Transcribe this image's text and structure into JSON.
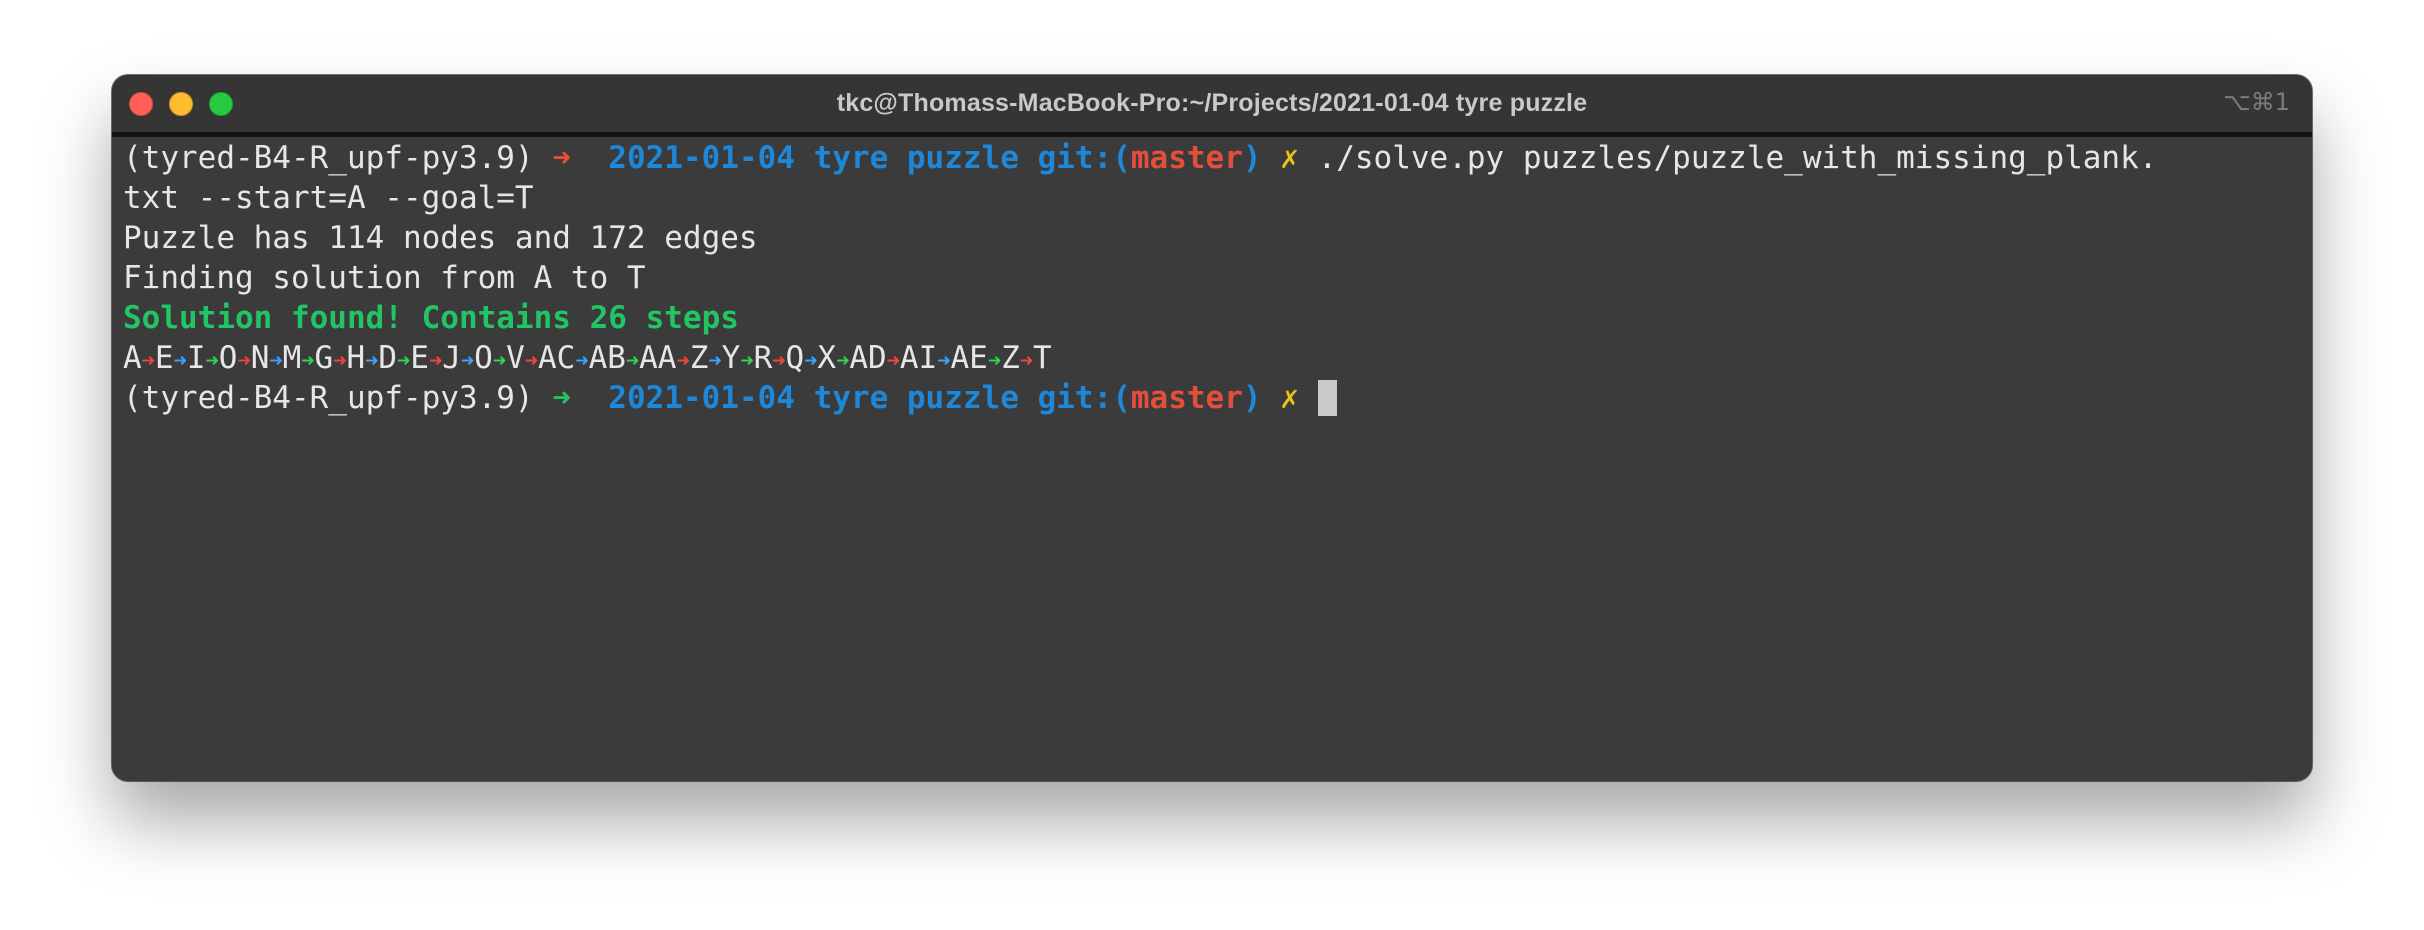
{
  "window": {
    "title": "tkc@Thomass-MacBook-Pro:~/Projects/2021-01-04 tyre puzzle",
    "shortcut": "⌥⌘1"
  },
  "terminal": {
    "prompt1": {
      "env": "(tyred-B4-R_upf-py3.9)",
      "arrow": "➜",
      "dir": "2021-01-04 tyre puzzle",
      "git_open": "git:(",
      "branch": "master",
      "git_close": ")",
      "dirty": "✗",
      "command": "./solve.py puzzles/puzzle_with_missing_plank.",
      "command_wrap": "txt --start=A --goal=T"
    },
    "output": {
      "line1": "Puzzle has 114 nodes and 172 edges",
      "line2": "Finding solution from A to T",
      "solution": "Solution found! Contains 26 steps"
    },
    "route": [
      {
        "node": "A",
        "arrow": "red"
      },
      {
        "node": "E",
        "arrow": "blue"
      },
      {
        "node": "I",
        "arrow": "green"
      },
      {
        "node": "O",
        "arrow": "red"
      },
      {
        "node": "N",
        "arrow": "blue"
      },
      {
        "node": "M",
        "arrow": "green"
      },
      {
        "node": "G",
        "arrow": "red"
      },
      {
        "node": "H",
        "arrow": "blue"
      },
      {
        "node": "D",
        "arrow": "green"
      },
      {
        "node": "E",
        "arrow": "red"
      },
      {
        "node": "J",
        "arrow": "blue"
      },
      {
        "node": "O",
        "arrow": "green"
      },
      {
        "node": "V",
        "arrow": "red"
      },
      {
        "node": "AC",
        "arrow": "blue"
      },
      {
        "node": "AB",
        "arrow": "green"
      },
      {
        "node": "AA",
        "arrow": "red"
      },
      {
        "node": "Z",
        "arrow": "blue"
      },
      {
        "node": "Y",
        "arrow": "green"
      },
      {
        "node": "R",
        "arrow": "red"
      },
      {
        "node": "Q",
        "arrow": "blue"
      },
      {
        "node": "X",
        "arrow": "green"
      },
      {
        "node": "AD",
        "arrow": "red"
      },
      {
        "node": "AI",
        "arrow": "blue"
      },
      {
        "node": "AE",
        "arrow": "green"
      },
      {
        "node": "Z",
        "arrow": "red"
      },
      {
        "node": "T",
        "arrow": null
      }
    ],
    "route_arrow_glyph": "➜",
    "prompt2": {
      "env": "(tyred-B4-R_upf-py3.9)",
      "arrow": "➜",
      "dir": "2021-01-04 tyre puzzle",
      "git_open": "git:(",
      "branch": "master",
      "git_close": ")",
      "dirty": "✗"
    }
  },
  "colors": {
    "background": "#3b3b3b",
    "titlebar": "#353535",
    "text": "#e6e6e6",
    "blue": "#1e87d8",
    "red": "#e54e3b",
    "green": "#22c564",
    "yellow": "#e6c119",
    "arrow_red": "#f0453a",
    "arrow_blue": "#3aa3ff",
    "arrow_green": "#2fd64c"
  }
}
